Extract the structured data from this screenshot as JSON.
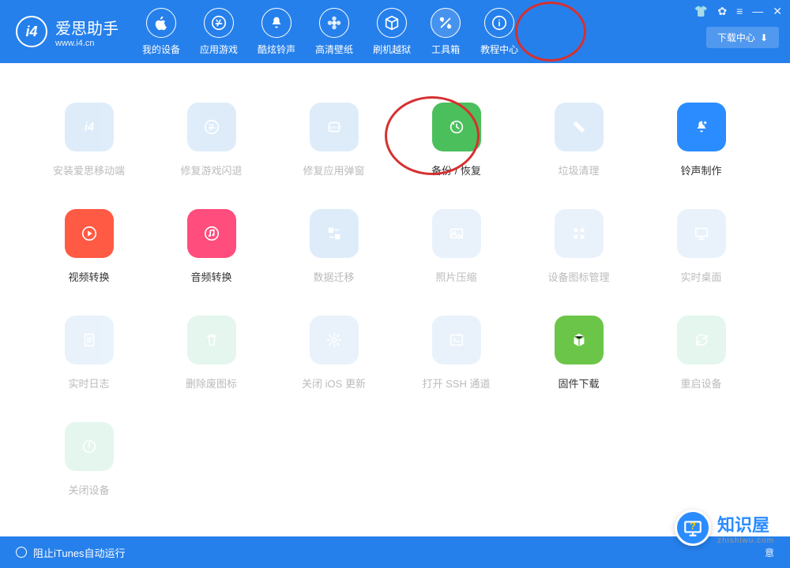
{
  "app": {
    "title": "爱思助手",
    "subtitle": "www.i4.cn"
  },
  "nav": [
    {
      "label": "我的设备",
      "icon": "apple"
    },
    {
      "label": "应用游戏",
      "icon": "appstore"
    },
    {
      "label": "酷炫铃声",
      "icon": "bell"
    },
    {
      "label": "高清壁纸",
      "icon": "flower"
    },
    {
      "label": "刷机越狱",
      "icon": "box"
    },
    {
      "label": "工具箱",
      "icon": "tools"
    },
    {
      "label": "教程中心",
      "icon": "info"
    }
  ],
  "downloadCenter": "下载中心",
  "tools": [
    {
      "label": "安装爱思移动端",
      "color": "#b8d6f5",
      "state": "disabled",
      "icon": "i4"
    },
    {
      "label": "修复游戏闪退",
      "color": "#b8d6f5",
      "state": "disabled",
      "icon": "appstore"
    },
    {
      "label": "修复应用弹窗",
      "color": "#b8d6f5",
      "state": "disabled",
      "icon": "appleid"
    },
    {
      "label": "备份 / 恢复",
      "color": "#4bbf5c",
      "state": "active",
      "icon": "restore",
      "highlight": true
    },
    {
      "label": "垃圾清理",
      "color": "#b8d6f5",
      "state": "disabled",
      "icon": "clean"
    },
    {
      "label": "铃声制作",
      "color": "#2a8cff",
      "state": "active",
      "icon": "bellplus"
    },
    {
      "label": "视频转换",
      "color": "#ff5a44",
      "state": "active",
      "icon": "play"
    },
    {
      "label": "音频转换",
      "color": "#ff4d7d",
      "state": "active",
      "icon": "music"
    },
    {
      "label": "数据迁移",
      "color": "#b8d6f5",
      "state": "disabled",
      "icon": "transfer"
    },
    {
      "label": "照片压缩",
      "color": "#cfe4f7",
      "state": "disabled",
      "icon": "photo"
    },
    {
      "label": "设备图标管理",
      "color": "#cfe4f7",
      "state": "disabled",
      "icon": "grid"
    },
    {
      "label": "实时桌面",
      "color": "#cfe4f7",
      "state": "disabled",
      "icon": "monitor"
    },
    {
      "label": "实时日志",
      "color": "#cfe4f7",
      "state": "disabled",
      "icon": "doc"
    },
    {
      "label": "删除废图标",
      "color": "#c4ecd9",
      "state": "disabled",
      "icon": "trash"
    },
    {
      "label": "关闭 iOS 更新",
      "color": "#cfe4f7",
      "state": "disabled",
      "icon": "gear"
    },
    {
      "label": "打开 SSH 通道",
      "color": "#cfe4f7",
      "state": "disabled",
      "icon": "ssh"
    },
    {
      "label": "固件下载",
      "color": "#6bc549",
      "state": "active",
      "icon": "cube"
    },
    {
      "label": "重启设备",
      "color": "#c4ecd9",
      "state": "disabled",
      "icon": "reload"
    },
    {
      "label": "关闭设备",
      "color": "#c4ecd9",
      "state": "disabled",
      "icon": "power"
    }
  ],
  "footer": {
    "preventItunes": "阻止iTunes自动运行",
    "rightHint": "意"
  },
  "watermark": {
    "text": "知识屋",
    "sub": "zhishiwu.com"
  }
}
